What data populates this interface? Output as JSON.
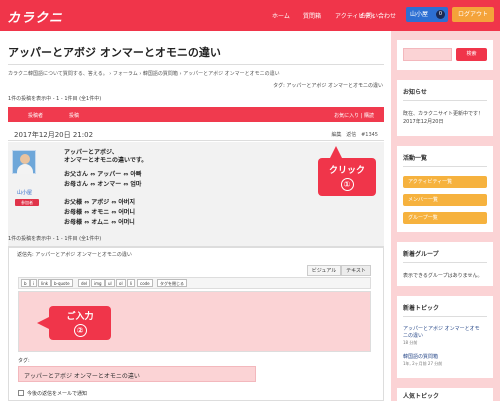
{
  "header": {
    "logo": "カラクニ",
    "nav": [
      "ホーム",
      "質問箱",
      "アクティビティ",
      "お問い合わせ"
    ],
    "user_button": "山小屋",
    "user_count": "0",
    "logout_button": "ログアウト"
  },
  "main": {
    "title": "アッパーとアボジ オンマーとオモニの違い",
    "breadcrumb": "カラクニ韓国語について質問する、答える。 › フォーラム › 韓国語の質問箱 › アッパーとアボジ オンマーとオモニの違い",
    "tag_line": "タグ: アッパーとアボジ オンマーとオモニの違い",
    "pager": "1件の投稿を表示中 - 1 - 1件目 (全1件中)",
    "table_head": {
      "author": "投稿者",
      "post": "投稿",
      "actions": "お気に入り | 購読"
    },
    "post": {
      "date": "2017年12月20日 21:02",
      "edit": "編集",
      "reply": "返信",
      "number": "#1345",
      "author": "山小屋",
      "badge": "参加者",
      "lines": [
        "アッパーとアボジ、",
        "オンマーとオモニの違いです。",
        "お父さん ⇔ アッパー ⇔ 아빠",
        "お母さん ⇔ オンマー ⇔ 엄마",
        "お父様 ⇔ アボジ ⇔ 아버지",
        "お母様 ⇔ オモニ ⇔ 어머니",
        "お母様 ⇔ オムニ ⇔ 어머니"
      ]
    },
    "pager_bottom": "1件の投稿を表示中 - 1 - 1件目 (全1件中)",
    "reply_form": {
      "label": "返信先: アッパーとアボジ オンマーとオモニの違い",
      "tab_visual": "ビジュアル",
      "tab_text": "テキスト",
      "quicktags": [
        "b",
        "i",
        "link",
        "b-quote",
        "del",
        "img",
        "ul",
        "ol",
        "li",
        "code",
        "タグを閉じる"
      ],
      "tag_label": "タグ:",
      "tag_value": "アッパーとアボジ オンマーとオモニの違い",
      "notify_label": "今後の返信をメールで通知"
    },
    "callouts": {
      "first_text": "クリック",
      "first_num": "①",
      "second_text": "ご入力",
      "second_num": "②"
    }
  },
  "sidebar": {
    "search_button": "検索",
    "notice_heading": "お知らせ",
    "notice_text_1": "既在、カラクニサイト更新中です！",
    "notice_text_2": "2017年12月20日",
    "activity_heading": "活動一覧",
    "activity_buttons": [
      "アクティビティ一覧",
      "メンバー一覧",
      "グループ一覧"
    ],
    "groups_heading": "新着グループ",
    "groups_text": "表示できるグループはありません。",
    "topics_heading": "新着トピック",
    "topics": [
      {
        "title": "アッパーとアボジ オンマーとオモ",
        "title2": "ニの違い",
        "meta": "18 分前"
      },
      {
        "title": "韓国語の質問箱",
        "meta": "1年, 2ヶ月前   27 分前"
      }
    ],
    "popular_heading": "人気トピック"
  }
}
